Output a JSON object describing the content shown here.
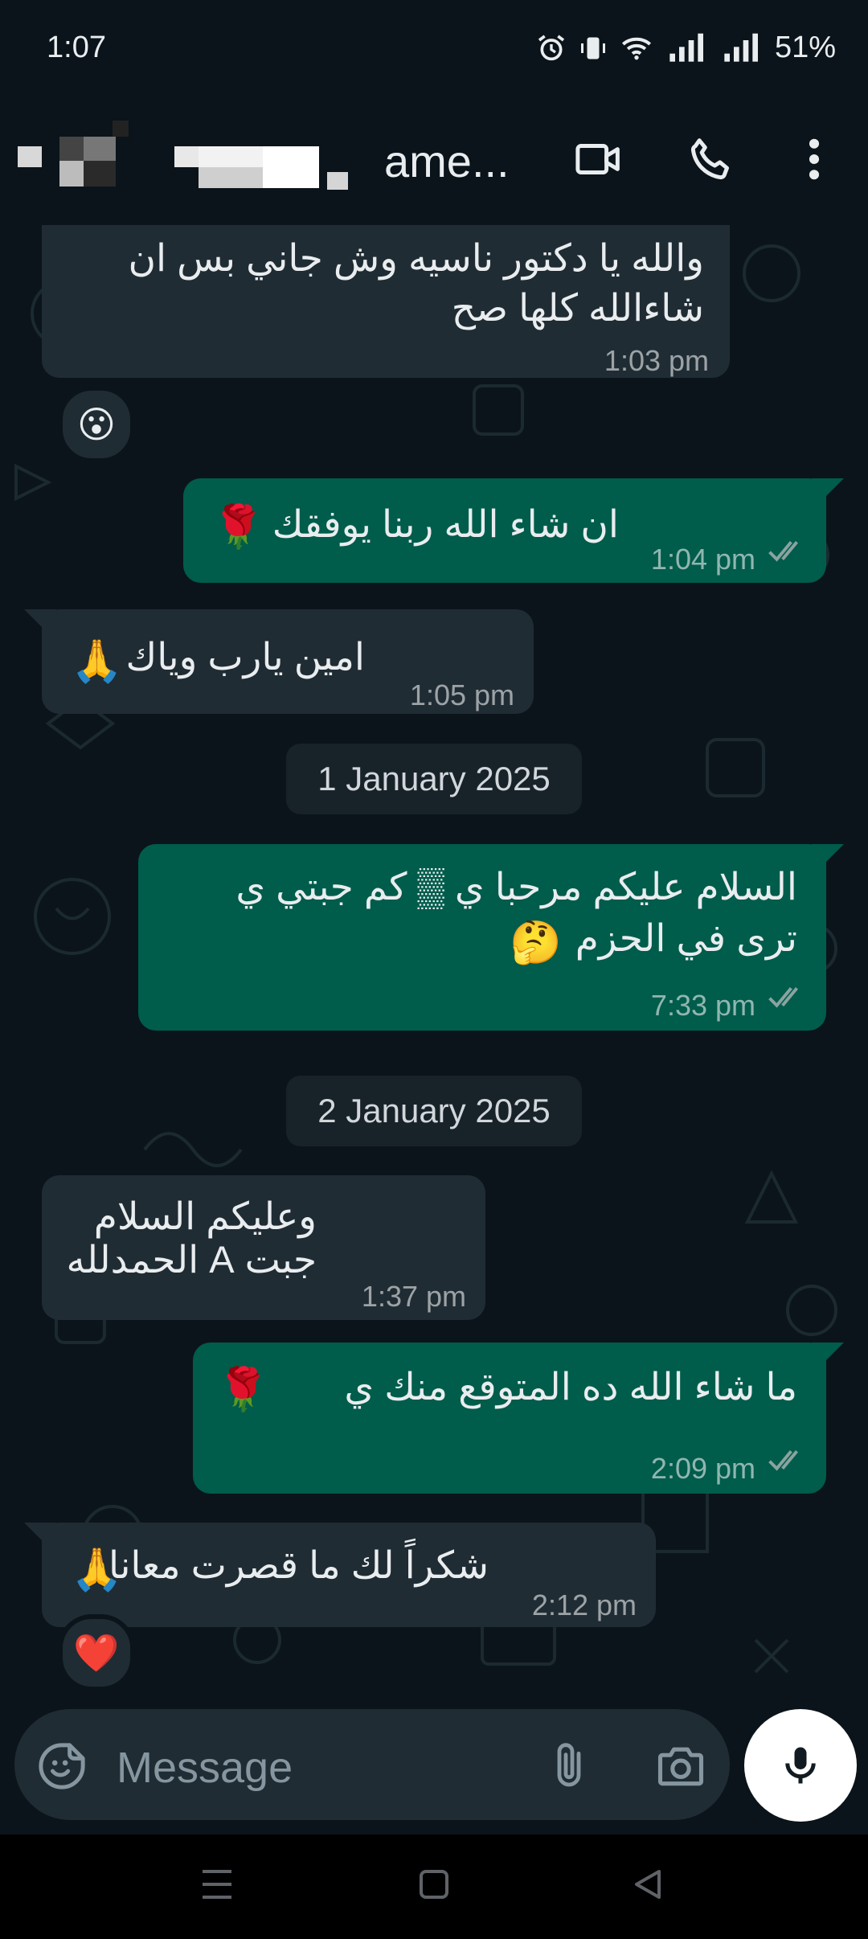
{
  "status_bar": {
    "time": "1:07",
    "battery": "51%"
  },
  "header": {
    "contact_name": "ame..."
  },
  "messages": [
    {
      "id": "m1",
      "direction": "incoming",
      "lines": [
        "والله يا دكتور ناسيه وش جاني بس ان",
        "شاءالله كلها صح"
      ],
      "time": "1:03 pm",
      "reaction": "😮"
    },
    {
      "id": "m2",
      "direction": "outgoing",
      "text": "ان شاء الله ربنا يوفقك",
      "emoji": "🌹",
      "time": "1:04 pm"
    },
    {
      "id": "m3",
      "direction": "incoming",
      "text": "امين يارب وياك",
      "emoji": "🙏",
      "time": "1:05 pm"
    },
    {
      "id": "m4",
      "direction": "outgoing",
      "lines": [
        "السلام عليكم مرحبا ي ▒ كم جبتي ي",
        "ترى في الحزم"
      ],
      "emoji": "🤔",
      "time": "7:33 pm"
    },
    {
      "id": "m5",
      "direction": "incoming",
      "lines": [
        "وعليكم السلام",
        "جبت A الحمدلله"
      ],
      "time": "1:37 pm"
    },
    {
      "id": "m6",
      "direction": "outgoing",
      "text": "ما شاء الله ده المتوقع منك ي",
      "emoji": "🌹",
      "time": "2:09 pm"
    },
    {
      "id": "m7",
      "direction": "incoming",
      "text": "شكراً لك ما قصرت معانا",
      "emoji": "🙏",
      "time": "2:12 pm",
      "reaction": "❤️"
    }
  ],
  "date_separators": [
    "1 January 2025",
    "2 January 2025"
  ],
  "composer": {
    "placeholder": "Message"
  },
  "colors": {
    "background": "#0b141a",
    "incoming_bubble": "#202c33",
    "outgoing_bubble": "#005c4b",
    "tick": "#8aa3a0"
  },
  "icons": [
    "alarm-icon",
    "vibrate-icon",
    "wifi-icon",
    "signal-icon",
    "video-call-icon",
    "phone-icon",
    "more-icon",
    "sticker-icon",
    "attach-icon",
    "camera-icon",
    "mic-icon",
    "nav-menu-icon",
    "nav-home-icon",
    "nav-back-icon"
  ]
}
